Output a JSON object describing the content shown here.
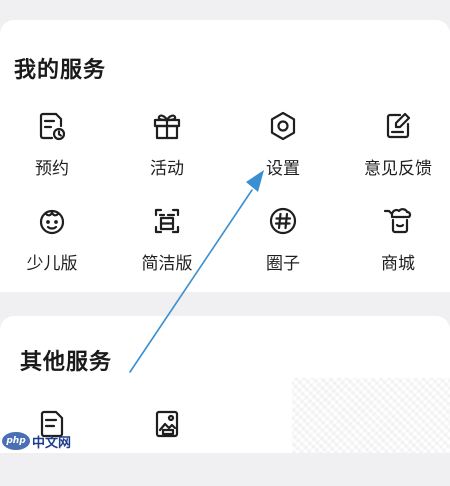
{
  "sections": {
    "my_services": {
      "title": "我的服务",
      "items": [
        {
          "label": "预约",
          "icon": "calendar-clock-icon"
        },
        {
          "label": "活动",
          "icon": "gift-icon"
        },
        {
          "label": "设置",
          "icon": "settings-icon"
        },
        {
          "label": "意见反馈",
          "icon": "feedback-edit-icon"
        },
        {
          "label": "少儿版",
          "icon": "kid-face-icon"
        },
        {
          "label": "简洁版",
          "icon": "simple-mode-icon"
        },
        {
          "label": "圈子",
          "icon": "hashtag-circle-icon"
        },
        {
          "label": "商城",
          "icon": "shop-icon"
        }
      ]
    },
    "other_services": {
      "title": "其他服务",
      "items": [
        {
          "label": "",
          "icon": "document-icon"
        },
        {
          "label": "",
          "icon": "image-doc-icon"
        }
      ]
    }
  },
  "watermark": {
    "logo_text": "php",
    "text": "中文网"
  },
  "colors": {
    "accent_arrow": "#3a8fd0",
    "icon_stroke": "#1f1f1f"
  }
}
